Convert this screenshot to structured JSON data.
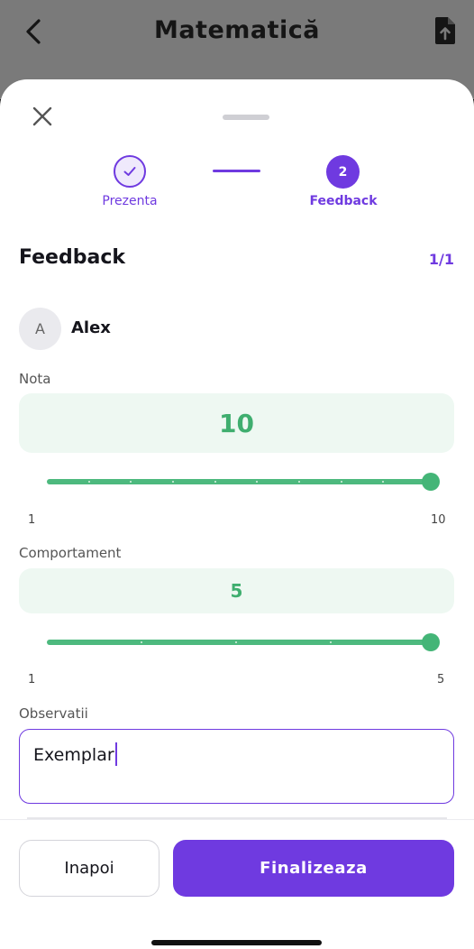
{
  "header": {
    "title": "Matematică"
  },
  "sheet": {
    "steps": [
      {
        "label": "Prezenta",
        "status": "done"
      },
      {
        "label": "Feedback",
        "number": "2",
        "status": "active"
      }
    ],
    "section_title": "Feedback",
    "counter": "1/1",
    "student": {
      "initial": "A",
      "name": "Alex"
    },
    "grade": {
      "label": "Nota",
      "value": "10",
      "min_label": "1",
      "max_label": "10",
      "min": 1,
      "max": 10,
      "current": 10
    },
    "behavior": {
      "label": "Comportament",
      "value": "5",
      "min_label": "1",
      "max_label": "5",
      "min": 1,
      "max": 5,
      "current": 5
    },
    "notes": {
      "label": "Observatii",
      "value": "Exemplar"
    }
  },
  "footer": {
    "back_label": "Inapoi",
    "finish_label": "Finalizeaza"
  },
  "colors": {
    "accent": "#6f3ae0",
    "success": "#44b577",
    "success_bg": "#eef8f2"
  }
}
